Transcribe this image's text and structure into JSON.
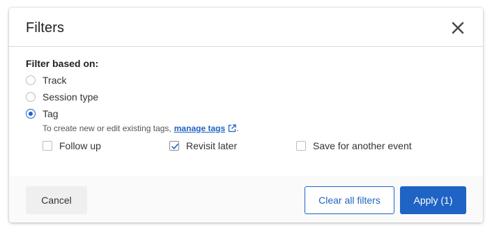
{
  "dialog": {
    "title": "Filters",
    "close_icon": "close-icon"
  },
  "filter": {
    "section_label": "Filter based on:",
    "options": [
      {
        "label": "Track",
        "selected": false
      },
      {
        "label": "Session type",
        "selected": false
      },
      {
        "label": "Tag",
        "selected": true
      }
    ],
    "helper_text": "To create new or edit existing tags,",
    "helper_link": "manage tags",
    "helper_suffix": ".",
    "helper_link_icon": "external-link-icon"
  },
  "tags": [
    {
      "label": "Follow up",
      "checked": false
    },
    {
      "label": "Revisit later",
      "checked": true
    },
    {
      "label": "Save for another event",
      "checked": false
    }
  ],
  "footer": {
    "cancel_label": "Cancel",
    "clear_label": "Clear all filters",
    "apply_label": "Apply (1)"
  },
  "colors": {
    "accent": "#1f63c4",
    "footer_bg": "#fafafa",
    "cancel_bg": "#efefef"
  }
}
